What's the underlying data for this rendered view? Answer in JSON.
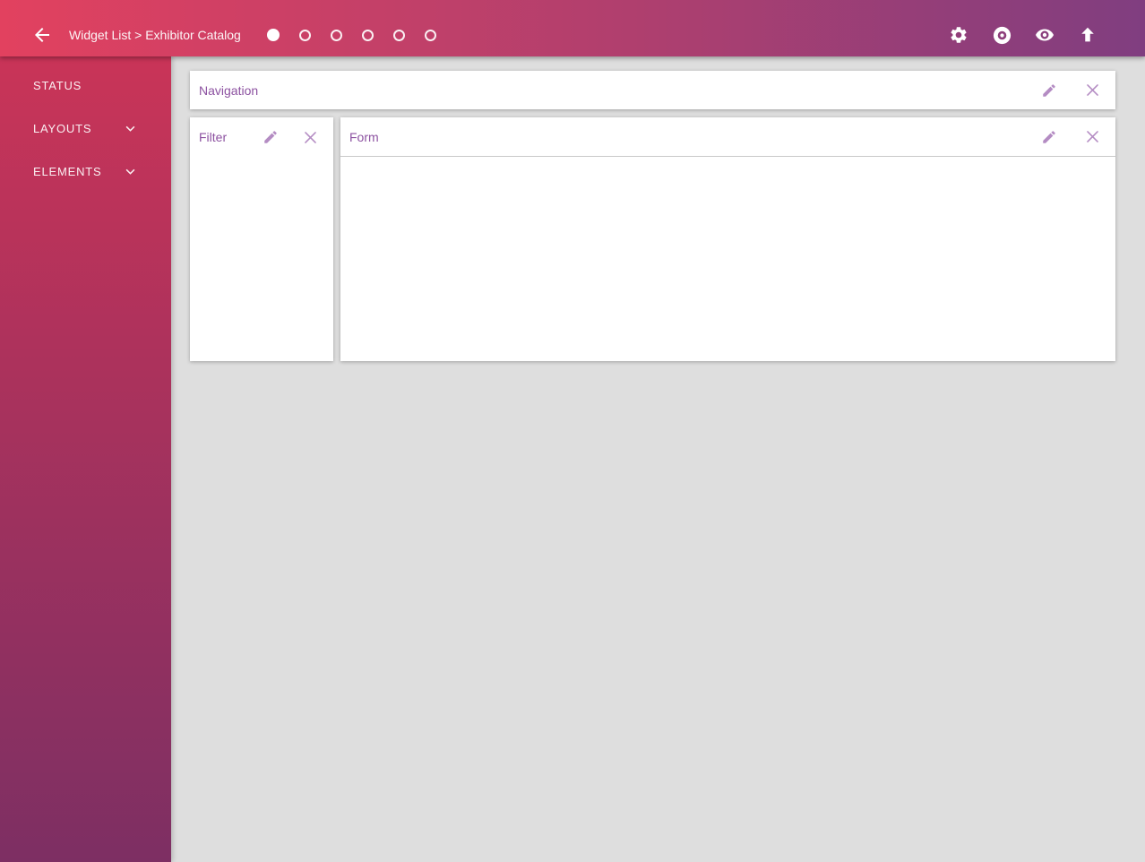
{
  "topbar": {
    "breadcrumb": "Widget List > Exhibitor Catalog",
    "steps": {
      "count": 6,
      "active_index": 0
    },
    "icons": [
      "settings-icon",
      "record-icon",
      "eye-icon",
      "upload-icon"
    ]
  },
  "sidebar": {
    "items": [
      {
        "label": "STATUS",
        "expandable": false
      },
      {
        "label": "LAYOUTS",
        "expandable": true
      },
      {
        "label": "ELEMENTS",
        "expandable": true
      }
    ]
  },
  "main": {
    "panels": [
      {
        "title": "Navigation"
      },
      {
        "title": "Filter"
      },
      {
        "title": "Form"
      }
    ]
  },
  "colors": {
    "topbar_gradient_left": "#e2415f",
    "topbar_gradient_right": "#803e80",
    "sidebar_gradient_top": "#c93458",
    "sidebar_gradient_bottom": "#7d2f63",
    "main_background": "#dedede",
    "panel_background": "#ffffff",
    "panel_title_text": "#8d52a1",
    "panel_icon": "#b48cc3",
    "topbar_icon": "#ffffff"
  }
}
